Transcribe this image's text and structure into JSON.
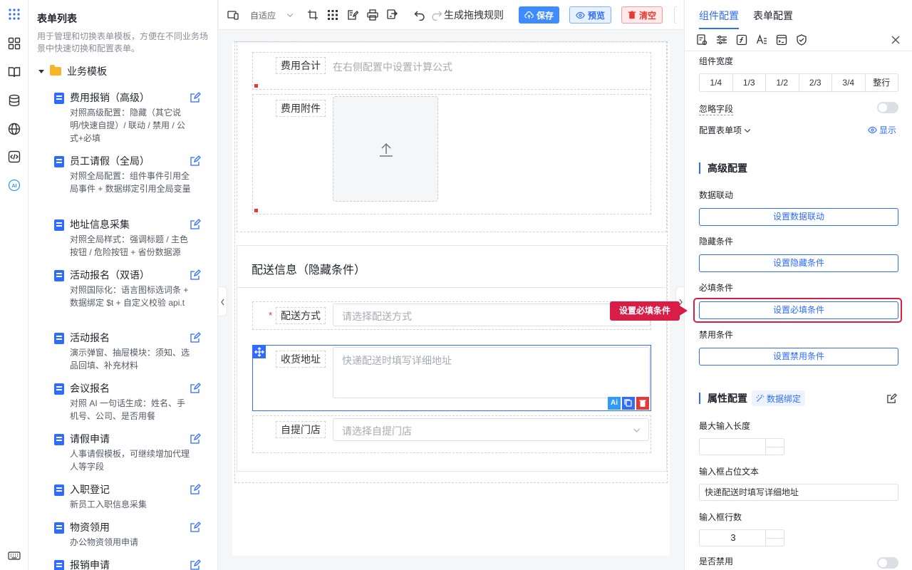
{
  "list": {
    "title": "表单列表",
    "description": "用于管理和切换表单模板，方便在不同业务场景中快速切换和配置表单。",
    "folder": "业务模板",
    "items": [
      {
        "title": "费用报销（高级）",
        "desc": "对照高级配置：隐藏（其它说明/快速自提）/ 联动 / 禁用 / 公式+必填"
      },
      {
        "title": "员工请假（全局）",
        "desc": "对照全局配置：组件事件引用全局事件 + 数据绑定引用全局变量"
      },
      {
        "title": "地址信息采集",
        "desc": "对照全局样式：强调标题 / 主色按钮 / 危险按钮 + 省份数据源"
      },
      {
        "title": "活动报名（双语）",
        "desc": "对照国际化：语言图标选词条 + 数据绑定 $t + 自定义校验 api.t"
      },
      {
        "title": "活动报名",
        "desc": "演示弹窗、抽屉模块：须知、选品回填、补充材料"
      },
      {
        "title": "会议报名",
        "desc": "对照 AI 一句话生成：姓名、手机号、公司、是否用餐"
      },
      {
        "title": "请假申请",
        "desc": "人事请假模板，可继续增加代理人等字段"
      },
      {
        "title": "入职登记",
        "desc": "新员工入职信息采集"
      },
      {
        "title": "物资领用",
        "desc": "办公物资领用申请"
      },
      {
        "title": "报销申请",
        "desc": ""
      }
    ]
  },
  "toolbar": {
    "adapt": "自适应",
    "gen_rule": "生成拖拽规则",
    "save": "保存",
    "preview": "预览",
    "clear": "清空"
  },
  "canvas": {
    "fee_total_label": "费用合计",
    "fee_total_ph": "在右侧配置中设置计算公式",
    "fee_attach_label": "费用附件",
    "delivery_title": "配送信息（隐藏条件）",
    "delivery_method_label": "配送方式",
    "delivery_method_ph": "请选择配送方式",
    "address_label": "收货地址",
    "address_ph": "快递配送时填写详细地址",
    "store_label": "自提门店",
    "store_ph": "请选择自提门店",
    "required_mark": "*"
  },
  "right": {
    "tab_component": "组件配置",
    "tab_form": "表单配置",
    "width_label": "组件宽度",
    "width_options": [
      "1/4",
      "1/3",
      "1/2",
      "2/3",
      "3/4",
      "整行"
    ],
    "ignore_field": "忽略字段",
    "config_item": "配置表单项",
    "show": "显示",
    "advanced": "高级配置",
    "linkage_label": "数据联动",
    "linkage_btn": "设置数据联动",
    "hidden_label": "隐藏条件",
    "hidden_btn": "设置隐藏条件",
    "required_label": "必填条件",
    "required_btn": "设置必填条件",
    "disabled_label": "禁用条件",
    "disabled_btn": "设置禁用条件",
    "props": "属性配置",
    "data_bind": "数据绑定",
    "maxlen_label": "最大输入长度",
    "placeholder_label": "输入框占位文本",
    "placeholder_value": "快递配送时填写详细地址",
    "rows_label": "输入框行数",
    "rows_value": "3",
    "is_disabled": "是否禁用"
  },
  "callout": "设置必填条件",
  "colors": {
    "accent": "#2f6bff",
    "callout": "#d81e46"
  }
}
